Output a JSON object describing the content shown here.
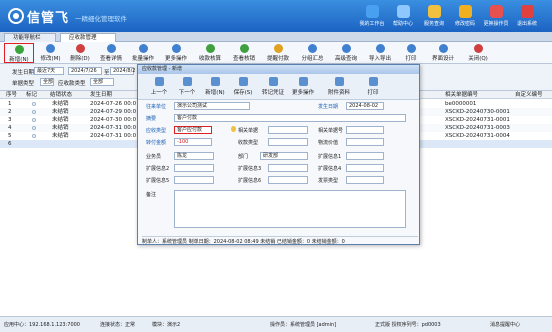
{
  "header": {
    "brand": "信管飞",
    "slogan": "一精细化管理软件",
    "buttons": [
      {
        "label": "我的工作台",
        "icon": "monitor-icon",
        "color": "#4aa0f0"
      },
      {
        "label": "帮助中心",
        "icon": "help-icon",
        "color": "#8ec8ff"
      },
      {
        "label": "服务查询",
        "icon": "service-icon",
        "color": "#f0c040"
      },
      {
        "label": "修改密码",
        "icon": "lock-icon",
        "color": "#f0b020"
      },
      {
        "label": "更换操作员",
        "icon": "user-switch-icon",
        "color": "#e85050"
      },
      {
        "label": "退出系统",
        "icon": "exit-icon",
        "color": "#e04040"
      }
    ]
  },
  "tabs": [
    {
      "label": "功能导航栏",
      "active": false
    },
    {
      "label": "应收款管理",
      "active": true
    }
  ],
  "toolbar": [
    {
      "label": "新增(N)",
      "icon": "add-icon",
      "color": "#3aa53a",
      "highlight": true
    },
    {
      "label": "修改(M)",
      "icon": "edit-icon",
      "color": "#4080d0"
    },
    {
      "label": "删除(D)",
      "icon": "delete-icon",
      "color": "#d04040"
    },
    {
      "label": "查看详情",
      "icon": "view-icon",
      "color": "#4080d0"
    },
    {
      "label": "批量操作",
      "icon": "batch-icon",
      "color": "#4080d0"
    },
    {
      "label": "更多操作",
      "icon": "more-icon",
      "color": "#4080d0"
    },
    {
      "label": "收款核算",
      "icon": "receive-icon",
      "color": "#40a040"
    },
    {
      "label": "查看核销",
      "icon": "checkoff-icon",
      "color": "#40a040"
    },
    {
      "label": "提醒付款",
      "icon": "remind-icon",
      "color": "#e0a020"
    },
    {
      "label": "分组汇总",
      "icon": "group-icon",
      "color": "#4080d0"
    },
    {
      "label": "高级查询",
      "icon": "search-icon",
      "color": "#4080d0"
    },
    {
      "label": "导入导出",
      "icon": "import-export-icon",
      "color": "#4080d0"
    },
    {
      "label": "打印",
      "icon": "print-icon",
      "color": "#4080d0"
    },
    {
      "label": "界面设计",
      "icon": "design-icon",
      "color": "#4080d0"
    },
    {
      "label": "关闭(Q)",
      "icon": "close-icon",
      "color": "#d04040"
    }
  ],
  "filter": {
    "date_label": "发生日期",
    "date_range": "最近7天",
    "date_from": "2024/7/26",
    "date_to": "2024/8/2",
    "range_sep": "至",
    "status_label": "单据类型",
    "status_value": "全部",
    "category_label": "应收款类型",
    "category_value": "全部"
  },
  "grid": {
    "columns": [
      "序号",
      "标记",
      "结销状态",
      "发生日期",
      "相关单据编号",
      "自定义编号"
    ],
    "rows": [
      {
        "no": "1",
        "status": "未结销",
        "date": "2024-07-26 00:0",
        "doc": "be0000001",
        "custom": ""
      },
      {
        "no": "2",
        "status": "未结销",
        "date": "2024-07-29 00:0",
        "doc": "XSCKD-20240730-0001",
        "custom": ""
      },
      {
        "no": "3",
        "status": "未结销",
        "date": "2024-07-30 00:0",
        "doc": "XSCKD-20240731-0001",
        "custom": ""
      },
      {
        "no": "4",
        "status": "未结销",
        "date": "2024-07-31 00:0",
        "doc": "XSCKD-20240731-0003",
        "custom": ""
      },
      {
        "no": "5",
        "status": "未结销",
        "date": "2024-07-31 00:0",
        "doc": "XSCKD-20240731-0004",
        "custom": ""
      }
    ],
    "last_row_no": "6"
  },
  "dialog": {
    "title": "应收款管理 - 新增",
    "tools": [
      {
        "label": "上一个",
        "icon": "prev-icon"
      },
      {
        "label": "下一个",
        "icon": "next-icon"
      },
      {
        "label": "新增(N)",
        "icon": "add-icon"
      },
      {
        "label": "保存(S)",
        "icon": "save-icon"
      },
      {
        "label": "转记凭证",
        "icon": "voucher-icon"
      },
      {
        "label": "更多操作",
        "icon": "more-icon"
      },
      {
        "label": "附件资料",
        "icon": "attachment-icon"
      },
      {
        "label": "打印",
        "icon": "print-icon"
      }
    ],
    "fields": {
      "unit_label": "往来单位",
      "unit_value": "演示公司测试",
      "date_label": "发生日期",
      "date_value": "2024-08-02",
      "summary_label": "摘要",
      "summary_value": "客户付款",
      "type_label": "应收类型",
      "type_value": "客户应付款",
      "contract_label": "相关单据",
      "contract_value": "",
      "related_no_label": "相关单据号",
      "related_no_value": "",
      "amount_label": "转付金额",
      "amount_value": "-100",
      "payment_label": "收款类型",
      "payment_value": "",
      "logistics_label": "物流价值",
      "logistics_value": "",
      "staff_label": "业务员",
      "staff_value": "陈龙",
      "dept_label": "部门",
      "dept_value": "研发部",
      "ext1_label": "扩展信息1",
      "ext2_label": "扩展信息2",
      "ext3_label": "扩展信息3",
      "ext4_label": "扩展信息4",
      "ext5_label": "扩展信息5",
      "ext6_label": "扩展信息6",
      "ext7_label": "扩展信息7",
      "ext8_label": "扩展信息8",
      "invoice_label": "发票类型",
      "invoice_value": "",
      "remark_label": "备注"
    },
    "footer": "制单人：系统管理员   制单日期：2024-08-02 08:49   未结销   已结销金额：0   未结销金额：0"
  },
  "statusbar": {
    "server": "应用中心：192.168.1.123:7000",
    "net": "连接状态：正常",
    "module": "模块：演示2",
    "operator": "操作员：系统管理员 [admin]",
    "version": "正式版  授权序列号：pd0003",
    "message": "消息提醒中心"
  },
  "colors": {
    "accent": "#1c63c2",
    "highlight": "#e02020"
  }
}
